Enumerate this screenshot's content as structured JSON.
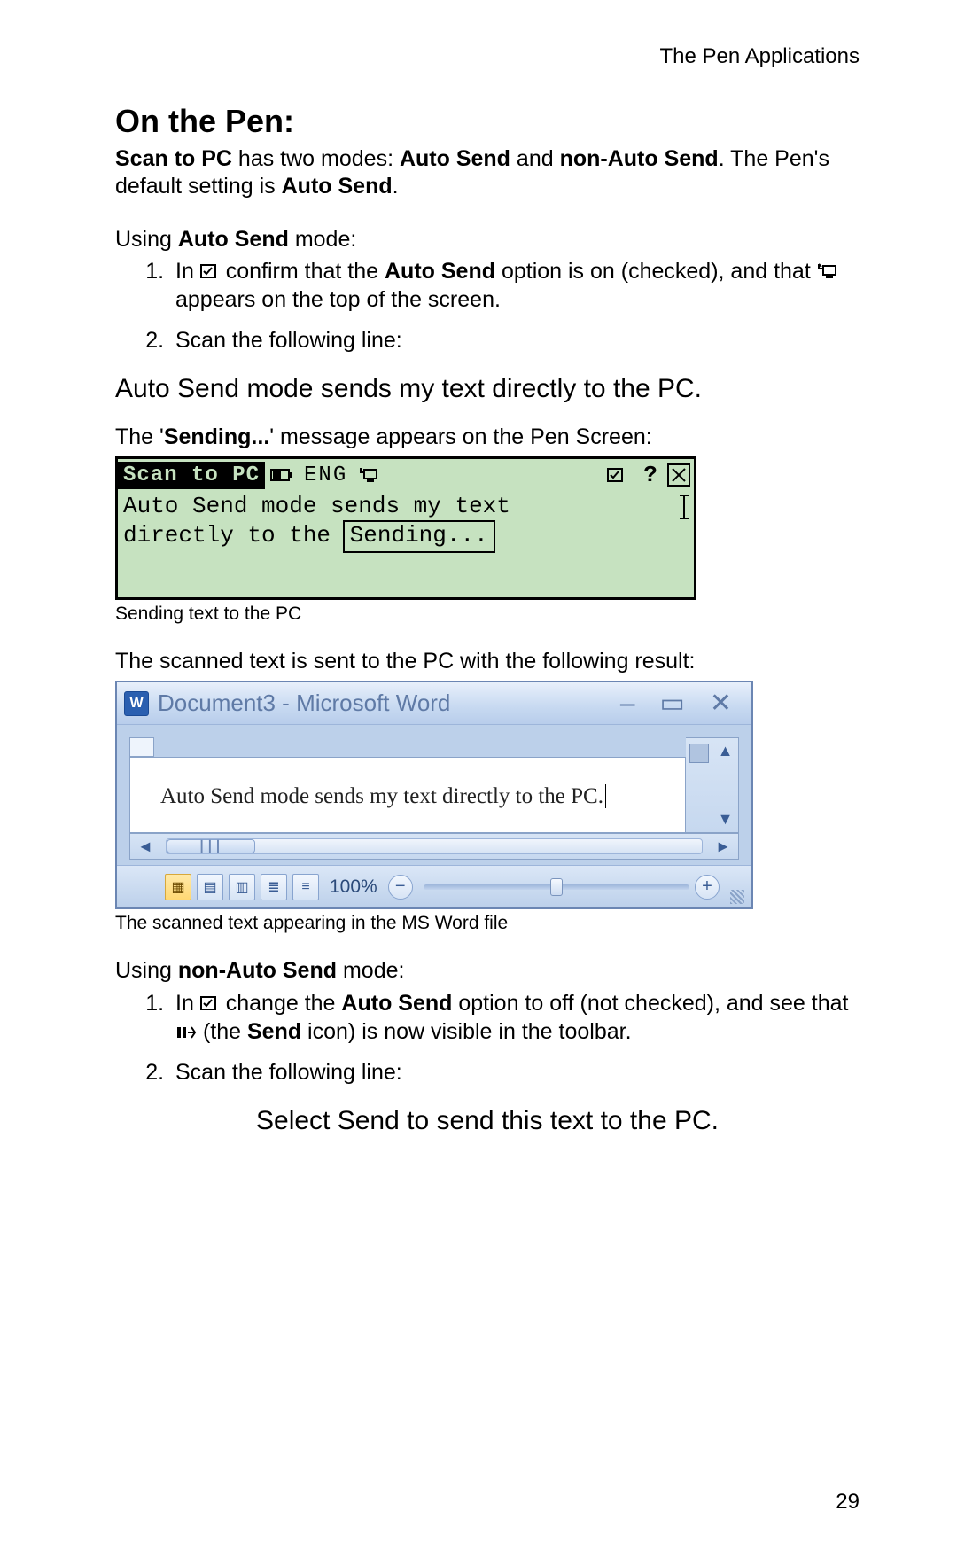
{
  "header": {
    "chapter": "The Pen Applications"
  },
  "title": "On the Pen:",
  "intro": {
    "seg1": "Scan to PC",
    "seg2": " has two modes: ",
    "seg3": "Auto Send",
    "seg4": " and ",
    "seg5": "non-Auto Send",
    "seg6": ". The Pen's default setting is ",
    "seg7": "Auto Send",
    "seg8": "."
  },
  "auto": {
    "heading_pre": "Using ",
    "heading_b": "Auto Send",
    "heading_post": " mode:",
    "step1_a": "In ",
    "step1_b": " confirm that the ",
    "step1_c": "Auto Send",
    "step1_d": " option is on (checked), and that ",
    "step1_e": " appears on the top of the screen.",
    "step2": "Scan the following line:",
    "scanline": "Auto Send mode sends my text directly to the PC.",
    "sending_pre": "The '",
    "sending_b": "Sending...",
    "sending_post": "' message appears on the Pen Screen:",
    "pen_caption": "Sending text to the PC",
    "result_text": "The scanned text is sent to the PC with the following result:",
    "word_caption": "The scanned text appearing in the MS Word file"
  },
  "pen_screen": {
    "app_label": "Scan to PC",
    "lang": "ENG",
    "line1": "Auto Send mode sends my text",
    "line2_pre": "directly to the",
    "sending": "Sending..."
  },
  "word": {
    "title": "Document3 - Microsoft Word",
    "content": "Auto Send mode sends my text directly to the PC.",
    "zoom": "100%"
  },
  "nonauto": {
    "heading_pre": "Using ",
    "heading_b": "non-Auto Send",
    "heading_post": " mode:",
    "step1_a": "In ",
    "step1_b": " change the ",
    "step1_c": "Auto Send",
    "step1_d": " option to off (not checked), and see that ",
    "step1_e": " (the ",
    "step1_f": "Send",
    "step1_g": " icon) is now visible in the toolbar.",
    "step2": "Scan the following line:",
    "scanline": "Select Send to send this text to the PC."
  },
  "page_number": "29"
}
